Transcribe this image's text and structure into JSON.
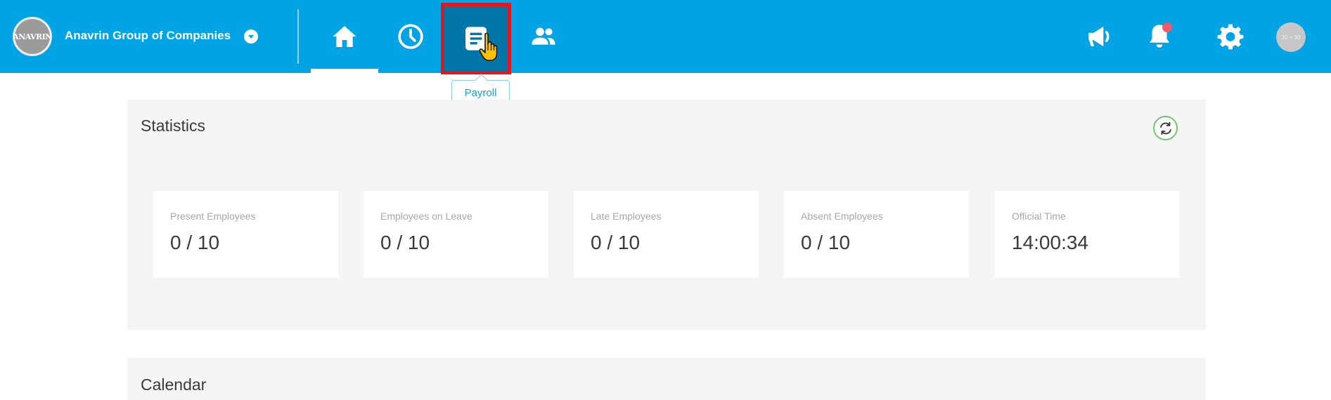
{
  "company": {
    "logo_text": "ANAVRIN",
    "name": "Anavrin Group of Companies"
  },
  "nav": {
    "tooltip": "Payroll"
  },
  "header": {
    "avatar_text": "30 × 30"
  },
  "statistics": {
    "title": "Statistics",
    "cards": [
      {
        "label": "Present Employees",
        "value": "0 / 10"
      },
      {
        "label": "Employees on Leave",
        "value": "0 / 10"
      },
      {
        "label": "Late Employees",
        "value": "0 / 10"
      },
      {
        "label": "Absent Employees",
        "value": "0 / 10"
      },
      {
        "label": "Official Time",
        "value": "14:00:34"
      }
    ]
  },
  "calendar": {
    "title": "Calendar"
  },
  "colors": {
    "topbar": "#00a4e4",
    "active_nav": "#0076a8",
    "highlight_border": "#e2161b",
    "notification_dot": "#ef5a6a"
  }
}
